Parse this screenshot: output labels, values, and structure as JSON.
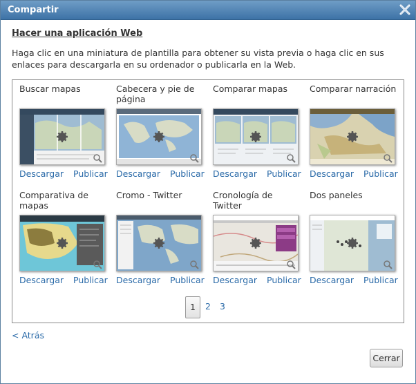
{
  "dialog": {
    "title": "Compartir",
    "close_icon": "close-icon"
  },
  "heading": "Hacer una aplicación Web",
  "description": "Haga clic en una miniatura de plantilla para obtener su vista previa o haga clic en sus enlaces para descargarla en su ordenador o publicarla en la Web.",
  "templates": [
    {
      "name": "Buscar mapas",
      "download": "Descargar",
      "publish": "Publicar",
      "thumbnail": "map-template-thumbnail"
    },
    {
      "name": "Cabecera y pie de página",
      "download": "Descargar",
      "publish": "Publicar",
      "thumbnail": "map-template-thumbnail"
    },
    {
      "name": "Comparar mapas",
      "download": "Descargar",
      "publish": "Publicar",
      "thumbnail": "map-template-thumbnail"
    },
    {
      "name": "Comparar narración",
      "download": "Descargar",
      "publish": "Publicar",
      "thumbnail": "map-template-thumbnail"
    },
    {
      "name": "Comparativa de mapas",
      "download": "Descargar",
      "publish": "Publicar",
      "thumbnail": "map-template-thumbnail"
    },
    {
      "name": "Cromo - Twitter",
      "download": "Descargar",
      "publish": "Publicar",
      "thumbnail": "map-template-thumbnail"
    },
    {
      "name": "Cronología de Twitter",
      "download": "Descargar",
      "publish": "Publicar",
      "thumbnail": "map-template-thumbnail"
    },
    {
      "name": "Dos paneles",
      "download": "Descargar",
      "publish": "Publicar",
      "thumbnail": "map-template-thumbnail"
    }
  ],
  "pagination": {
    "pages": [
      "1",
      "2",
      "3"
    ],
    "current": "1"
  },
  "back_label": "< Atrás",
  "close_button": "Cerrar",
  "colors": {
    "titlebar": "#3d72a6",
    "link": "#2a6aa8"
  }
}
